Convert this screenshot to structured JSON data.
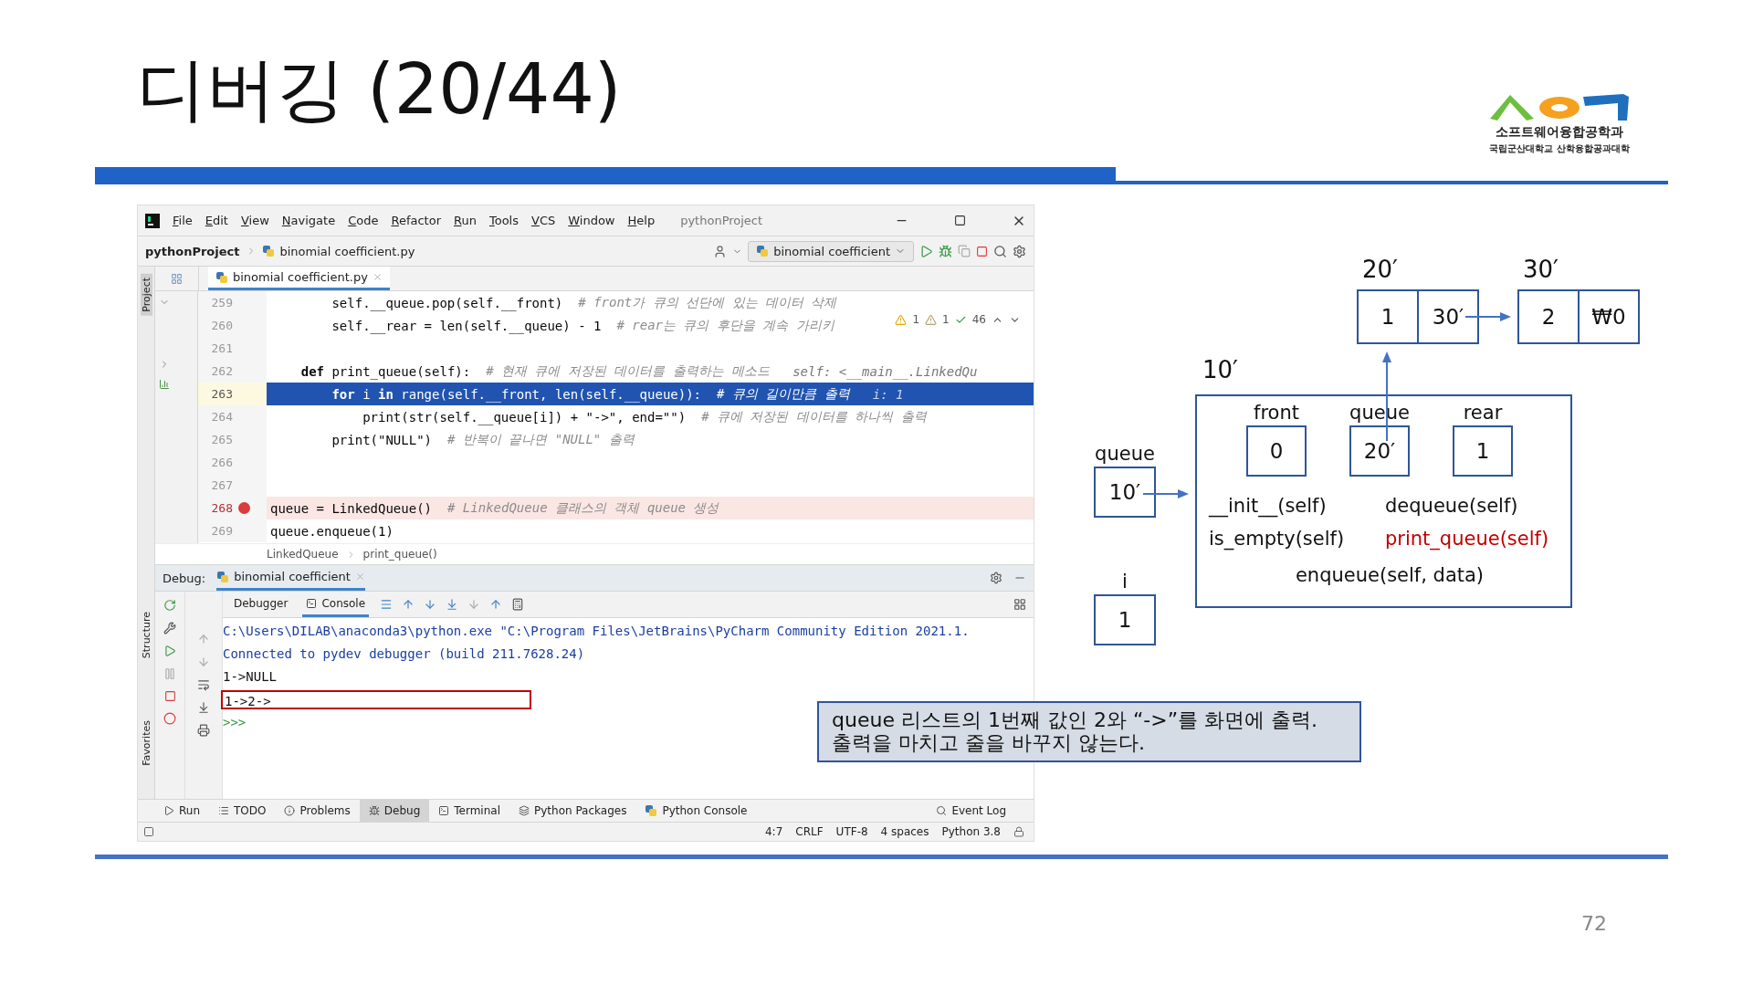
{
  "slide": {
    "title": "디버깅 (20/44)",
    "page_number": "72"
  },
  "logo": {
    "name": "소프트웨어융합공학과",
    "subtitle": "국립군산대학교 산학융합공과대학"
  },
  "ide": {
    "menu": [
      "File",
      "Edit",
      "View",
      "Navigate",
      "Code",
      "Refactor",
      "Run",
      "Tools",
      "VCS",
      "Window",
      "Help"
    ],
    "project_name": "pythonProject",
    "breadcrumbs": [
      "pythonProject",
      "binomial coefficient.py"
    ],
    "run_config": "binomial coefficient",
    "left_tools": [
      {
        "label": "Project",
        "selected": true
      }
    ],
    "editor_tab": "binomial coefficient.py",
    "inspections": [
      {
        "kind": "error",
        "count": "1"
      },
      {
        "kind": "warning",
        "count": "1"
      },
      {
        "kind": "ok",
        "count": "46"
      }
    ],
    "lines": [
      {
        "number": "259",
        "code": "        self.__queue.pop(self.__front)",
        "comment": "# front가 큐의 선단에 있는 데이터 삭제",
        "current": false,
        "breakpoint": false
      },
      {
        "number": "260",
        "code": "        self.__rear = len(self.__queue) - 1",
        "comment": "# rear는 큐의 후단을 계속 가리키",
        "current": false,
        "breakpoint": false
      },
      {
        "number": "261",
        "current": false,
        "breakpoint": false
      },
      {
        "number": "262",
        "code": "    **def** print_queue(self):",
        "comment": "# 현재 큐에 저장된 데이터를 출력하는 메소드",
        "hint": "self: <__main__.LinkedQu",
        "current": false,
        "breakpoint": false
      },
      {
        "number": "263",
        "code": "        **for** i **in** range(self.__front, len(self.__queue)):",
        "comment": "# 큐의 길이만큼 출력",
        "hint": "i: 1",
        "current": true,
        "breakpoint": false
      },
      {
        "number": "264",
        "code": "            print(str(self.__queue[i]) + \"->\", end=\"\")",
        "comment": "# 큐에 저장된 데이터를 하나씩 출력",
        "current": false,
        "breakpoint": false
      },
      {
        "number": "265",
        "code": "        print(\"NULL\")",
        "comment": "# 반복이 끝나면 \"NULL\" 출력",
        "current": false,
        "breakpoint": false
      },
      {
        "number": "266",
        "current": false,
        "breakpoint": false
      },
      {
        "number": "267",
        "current": false,
        "breakpoint": false
      },
      {
        "number": "268",
        "code": "queue = LinkedQueue()",
        "comment": "# LinkedQueue 클래스의 객체 queue 생성",
        "current": false,
        "breakpoint": true
      },
      {
        "number": "269",
        "code": "queue.enqueue(1)",
        "current": false,
        "breakpoint": false
      }
    ],
    "code_breadcrumbs": [
      "LinkedQueue",
      "print_queue()"
    ],
    "debug": {
      "label": "Debug:",
      "session": "binomial coefficient",
      "tabs": [
        {
          "label": "Debugger",
          "selected": false
        },
        {
          "label": "Console",
          "selected": true
        }
      ],
      "console": [
        {
          "text": "C:\\Users\\DILAB\\anaconda3\\python.exe \"C:\\Program Files\\JetBrains\\PyCharm Community Edition 2021.1.",
          "kind": "system",
          "highlighted": false
        },
        {
          "text": "Connected to pydev debugger (build 211.7628.24)",
          "kind": "system",
          "highlighted": false
        },
        {
          "text": "1->NULL",
          "kind": "output",
          "highlighted": false
        },
        {
          "text": "1->2->",
          "kind": "output",
          "highlighted": true
        },
        {
          "text": ">>>",
          "kind": "prompt",
          "highlighted": false
        }
      ]
    },
    "side_tools": [
      {
        "label": "Structure",
        "selected": false
      },
      {
        "label": "Favorites",
        "selected": false
      }
    ],
    "tool_tabs": [
      {
        "label": "Run",
        "kind": "run",
        "selected": false
      },
      {
        "label": "TODO",
        "kind": "todo",
        "selected": false
      },
      {
        "label": "Problems",
        "kind": "problems",
        "selected": false
      },
      {
        "label": "Debug",
        "kind": "debug",
        "selected": true
      },
      {
        "label": "Terminal",
        "kind": "terminal",
        "selected": false
      },
      {
        "label": "Python Packages",
        "kind": "packages",
        "selected": false
      },
      {
        "label": "Python Console",
        "kind": "console",
        "selected": false
      }
    ],
    "event_log": "Event Log",
    "status": [
      "4:7",
      "CRLF",
      "UTF-8",
      "4 spaces",
      "Python 3.8"
    ]
  },
  "diagram": {
    "nodes": [
      {
        "address": "20′",
        "data": "1",
        "link": "30′"
      },
      {
        "address": "30′",
        "data": "2",
        "link": "₩0"
      }
    ],
    "object": {
      "address": "10′",
      "fields": [
        {
          "name": "front",
          "value": "0"
        },
        {
          "name": "queue",
          "value": "20′"
        },
        {
          "name": "rear",
          "value": "1"
        }
      ],
      "methods": [
        {
          "label": "__init__(self)",
          "highlighted": false
        },
        {
          "label": "dequeue(self)",
          "highlighted": false
        },
        {
          "label": "is_empty(self)",
          "highlighted": false
        },
        {
          "label": "print_queue(self)",
          "highlighted": true
        },
        {
          "label": "enqueue(self, data)",
          "highlighted": false
        }
      ]
    },
    "variables": [
      {
        "name": "queue",
        "value": "10′"
      },
      {
        "name": "i",
        "value": "1"
      }
    ]
  },
  "callout": [
    "queue 리스트의 1번째 값인 2와 “->”를 화면에 출력.",
    "출력을 마치고 줄을 바꾸지 않는다."
  ]
}
